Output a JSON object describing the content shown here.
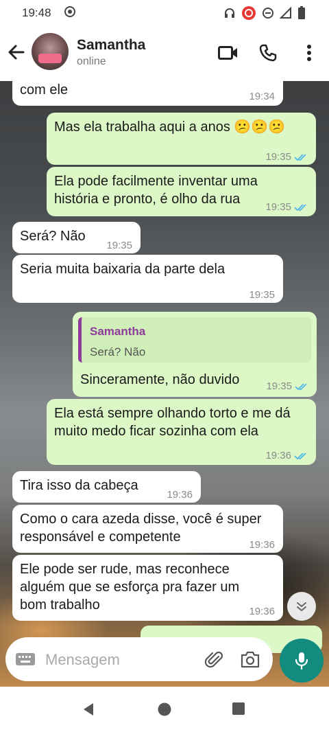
{
  "status_bar": {
    "time": "19:48"
  },
  "header": {
    "contact_name": "Samantha",
    "contact_status": "online"
  },
  "partial_top": {
    "text": "com ele",
    "time": "19:34"
  },
  "messages": [
    {
      "dir": "out",
      "text": "Mas ela trabalha aqui a anos 😕😕😕",
      "time": "19:35",
      "read": true
    },
    {
      "dir": "out",
      "text": "Ela pode facilmente inventar uma história e pronto, é olho da rua",
      "time": "19:35",
      "read": true
    },
    {
      "dir": "in",
      "text": "Será? Não",
      "time": "19:35"
    },
    {
      "dir": "in",
      "text": "Seria muita baixaria da parte dela",
      "time": "19:35"
    },
    {
      "dir": "out",
      "quote_author": "Samantha",
      "quote_text": "Será? Não",
      "text": "Sinceramente, não duvido",
      "time": "19:35",
      "read": true
    },
    {
      "dir": "out",
      "text": "Ela está sempre olhando torto e me dá muito medo ficar sozinha com ela",
      "time": "19:36",
      "read": true
    },
    {
      "dir": "in",
      "text": "Tira isso da cabeça",
      "time": "19:36"
    },
    {
      "dir": "in",
      "text": "Como o cara azeda disse, você é super responsável e competente",
      "time": "19:36"
    },
    {
      "dir": "in",
      "text": "Ele pode ser rude, mas reconhece alguém que se esforça pra fazer um bom trabalho",
      "time": "19:36"
    }
  ],
  "composer": {
    "placeholder": "Mensagem"
  },
  "colors": {
    "outgoing_bubble": "#dcf8c6",
    "incoming_bubble": "#ffffff",
    "accent": "#128c7e",
    "read_ticks": "#4fb6ec"
  },
  "icons": [
    "back-arrow-icon",
    "video-call-icon",
    "phone-icon",
    "more-vert-icon",
    "keyboard-icon",
    "attach-icon",
    "camera-icon",
    "mic-icon",
    "double-check-icon",
    "scroll-down-icon",
    "nav-back-icon",
    "nav-home-icon",
    "nav-recents-icon"
  ]
}
